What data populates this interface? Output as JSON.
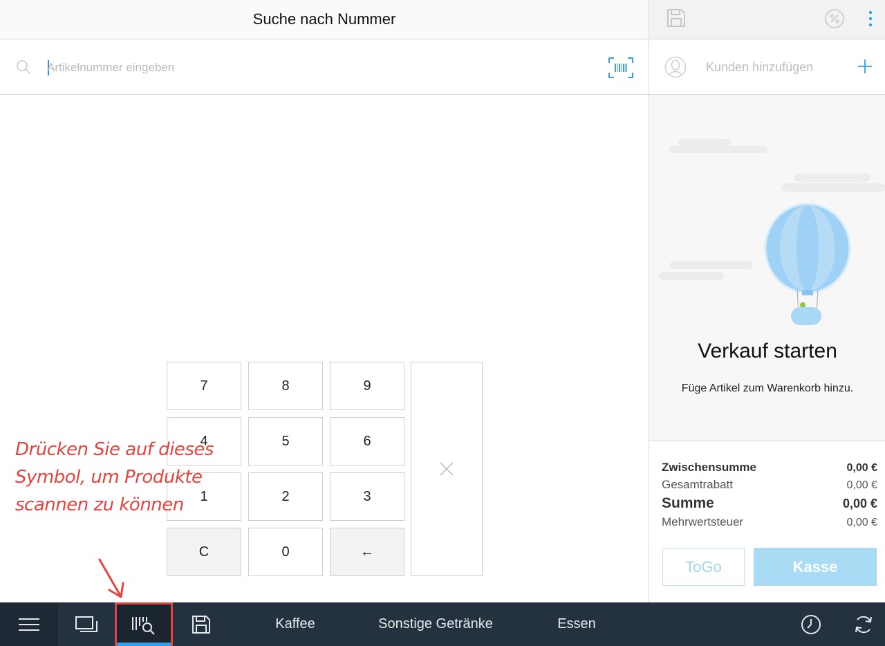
{
  "header": {
    "title": "Suche nach Nummer"
  },
  "search": {
    "placeholder": "Artikelnummer eingeben",
    "value": ""
  },
  "keypad": {
    "keys": [
      "7",
      "8",
      "9",
      "4",
      "5",
      "6",
      "1",
      "2",
      "3",
      "C",
      "0",
      "←"
    ],
    "clear_label": "×"
  },
  "annotation": {
    "lines": [
      "Drücken Sie auf dieses",
      "Symbol, um Produkte",
      "scannen zu können"
    ],
    "color": "#e2453f"
  },
  "customer": {
    "label": "Kunden hinzufügen"
  },
  "cart": {
    "heading": "Verkauf starten",
    "subtext": "Füge Artikel zum Warenkorb hinzu."
  },
  "totals": {
    "subtotal_label": "Zwischensumme",
    "subtotal_value": "0,00 €",
    "discount_label": "Gesamtrabatt",
    "discount_value": "0,00 €",
    "sum_label": "Summe",
    "sum_value": "0,00 €",
    "vat_label": "Mehrwertsteuer",
    "vat_value": "0,00 €"
  },
  "actions": {
    "togo_label": "ToGo",
    "checkout_label": "Kasse"
  },
  "bottombar": {
    "categories": [
      "Kaffee",
      "Sonstige Getränke",
      "Essen"
    ],
    "active_indicator_color": "#2ea1f0"
  },
  "colors": {
    "accent": "#2ea1f0",
    "bar_bg": "#243240",
    "checkout_bg": "#a9dcf4"
  }
}
